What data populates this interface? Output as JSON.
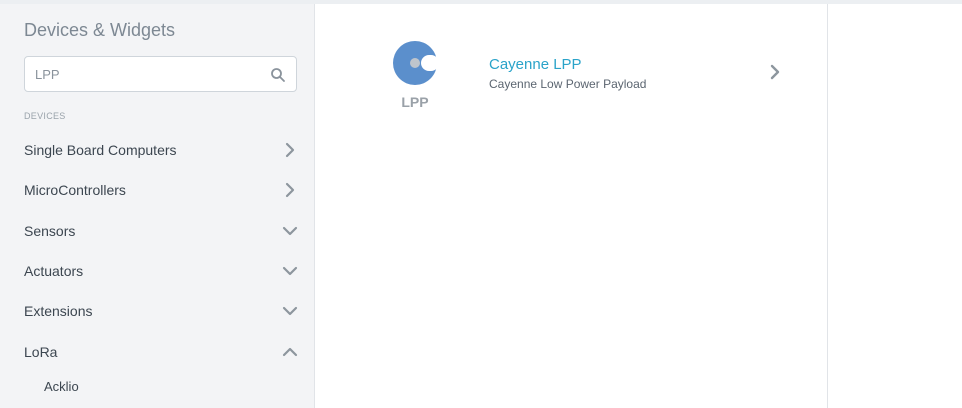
{
  "sidebar": {
    "title": "Devices & Widgets",
    "search": {
      "value": "LPP",
      "placeholder": "Search"
    },
    "section_label": "DEVICES",
    "items": [
      {
        "label": "Single Board Computers",
        "chevron": "right"
      },
      {
        "label": "MicroControllers",
        "chevron": "right"
      },
      {
        "label": "Sensors",
        "chevron": "down"
      },
      {
        "label": "Actuators",
        "chevron": "down"
      },
      {
        "label": "Extensions",
        "chevron": "down"
      },
      {
        "label": "LoRa",
        "chevron": "up"
      }
    ],
    "subitems": [
      {
        "label": "Acklio"
      }
    ]
  },
  "results": [
    {
      "title": "Cayenne LPP",
      "subtitle": "Cayenne Low Power Payload",
      "logo_text": "LPP",
      "logo_icon": "cayenne-logo-icon"
    }
  ],
  "colors": {
    "sidebar_bg": "#f3f4f6",
    "link": "#2aa3c9",
    "logo_blue": "#5b8fcc",
    "text": "#3c4650",
    "chevron": "#8d969e"
  }
}
